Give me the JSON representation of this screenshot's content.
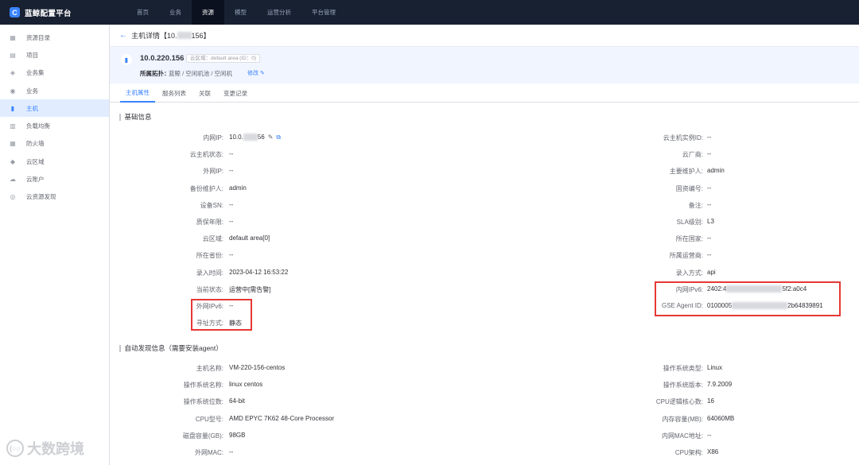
{
  "app": {
    "logo_letter": "C",
    "title": "蓝鲸配置平台"
  },
  "topnav": [
    {
      "label": "首页",
      "active": false
    },
    {
      "label": "业务",
      "active": false
    },
    {
      "label": "资源",
      "active": true
    },
    {
      "label": "模型",
      "active": false
    },
    {
      "label": "运营分析",
      "active": false
    },
    {
      "label": "平台管理",
      "active": false
    }
  ],
  "sidebar": [
    {
      "label": "资源目录",
      "icon": "grid-icon",
      "active": false
    },
    {
      "label": "项目",
      "icon": "project-icon",
      "active": false
    },
    {
      "label": "业务集",
      "icon": "business-set-icon",
      "active": false
    },
    {
      "label": "业务",
      "icon": "business-icon",
      "active": false
    },
    {
      "label": "主机",
      "icon": "host-icon",
      "active": true
    },
    {
      "label": "负载均衡",
      "icon": "load-balancer-icon",
      "active": false
    },
    {
      "label": "防火墙",
      "icon": "firewall-icon",
      "active": false
    },
    {
      "label": "云区域",
      "icon": "cloud-area-icon",
      "active": false
    },
    {
      "label": "云账户",
      "icon": "cloud-account-icon",
      "active": false
    },
    {
      "label": "云资源发现",
      "icon": "cloud-discovery-icon",
      "active": false
    }
  ],
  "breadcrumb": {
    "prefix": "主机详情【10.",
    "suffix": "156】"
  },
  "host": {
    "ip": "10.0.220.156",
    "area_tag": "云区域：default area (ID：0)",
    "topo_label": "所属拓扑：",
    "topo_value": "蓝鲸 / 空闲机池 / 空闲机",
    "edit_label": "修改"
  },
  "tabs": [
    {
      "label": "主机属性",
      "active": true
    },
    {
      "label": "服务列表",
      "active": false
    },
    {
      "label": "关联",
      "active": false
    },
    {
      "label": "变更记录",
      "active": false
    }
  ],
  "sections": {
    "basic": "基础信息",
    "auto": "自动发现信息（需要安装agent）"
  },
  "basic_left": [
    {
      "label": "内网IP:",
      "value": "10.0.",
      "value_tail": "56"
    },
    {
      "label": "云主机状态:",
      "value": "--"
    },
    {
      "label": "外网IP:",
      "value": "--"
    },
    {
      "label": "备份维护人:",
      "value": "admin"
    },
    {
      "label": "设备SN:",
      "value": "--"
    },
    {
      "label": "质保年限:",
      "value": "--"
    },
    {
      "label": "云区域:",
      "value": "default area[0]"
    },
    {
      "label": "所在省份:",
      "value": "--"
    },
    {
      "label": "录入时间:",
      "value": "2023-04-12 16:53:22"
    },
    {
      "label": "当前状态:",
      "value": "运营中[需告警]"
    },
    {
      "label": "外网IPv6:",
      "value": "--"
    },
    {
      "label": "寻址方式:",
      "value": "静态"
    }
  ],
  "basic_right": [
    {
      "label": "云主机实例ID:",
      "value": "--"
    },
    {
      "label": "云厂商:",
      "value": "--"
    },
    {
      "label": "主要维护人:",
      "value": "admin"
    },
    {
      "label": "固资编号:",
      "value": "--"
    },
    {
      "label": "备注:",
      "value": "--"
    },
    {
      "label": "SLA级别:",
      "value": "L3"
    },
    {
      "label": "所在国家:",
      "value": "--"
    },
    {
      "label": "所属运营商:",
      "value": "--"
    },
    {
      "label": "录入方式:",
      "value": "api"
    },
    {
      "label": "内网IPv6:",
      "value": "2402:4",
      "value_tail": "5f2:a0c4"
    },
    {
      "label": "GSE Agent ID:",
      "value": "0100005",
      "value_tail": "2b64839891"
    }
  ],
  "auto_left": [
    {
      "label": "主机名称:",
      "value": "VM-220-156-centos"
    },
    {
      "label": "操作系统名称:",
      "value": "linux centos"
    },
    {
      "label": "操作系统位数:",
      "value": "64-bit"
    },
    {
      "label": "CPU型号:",
      "value": "AMD EPYC 7K62 48-Core Processor"
    },
    {
      "label": "磁盘容量(GB):",
      "value": "98GB"
    },
    {
      "label": "外网MAC:",
      "value": "--"
    }
  ],
  "auto_right": [
    {
      "label": "操作系统类型:",
      "value": "Linux"
    },
    {
      "label": "操作系统版本:",
      "value": "7.9.2009"
    },
    {
      "label": "CPU逻辑核心数:",
      "value": "16"
    },
    {
      "label": "内存容量(MB):",
      "value": "64060MB"
    },
    {
      "label": "内网MAC地址:",
      "value": "--"
    },
    {
      "label": "CPU架构:",
      "value": "X86"
    }
  ],
  "watermark": {
    "logo": "(○○",
    "text": "大数跨境"
  },
  "colors": {
    "accent": "#3a84ff",
    "nav_bg": "#182132",
    "highlight": "#e53935"
  }
}
